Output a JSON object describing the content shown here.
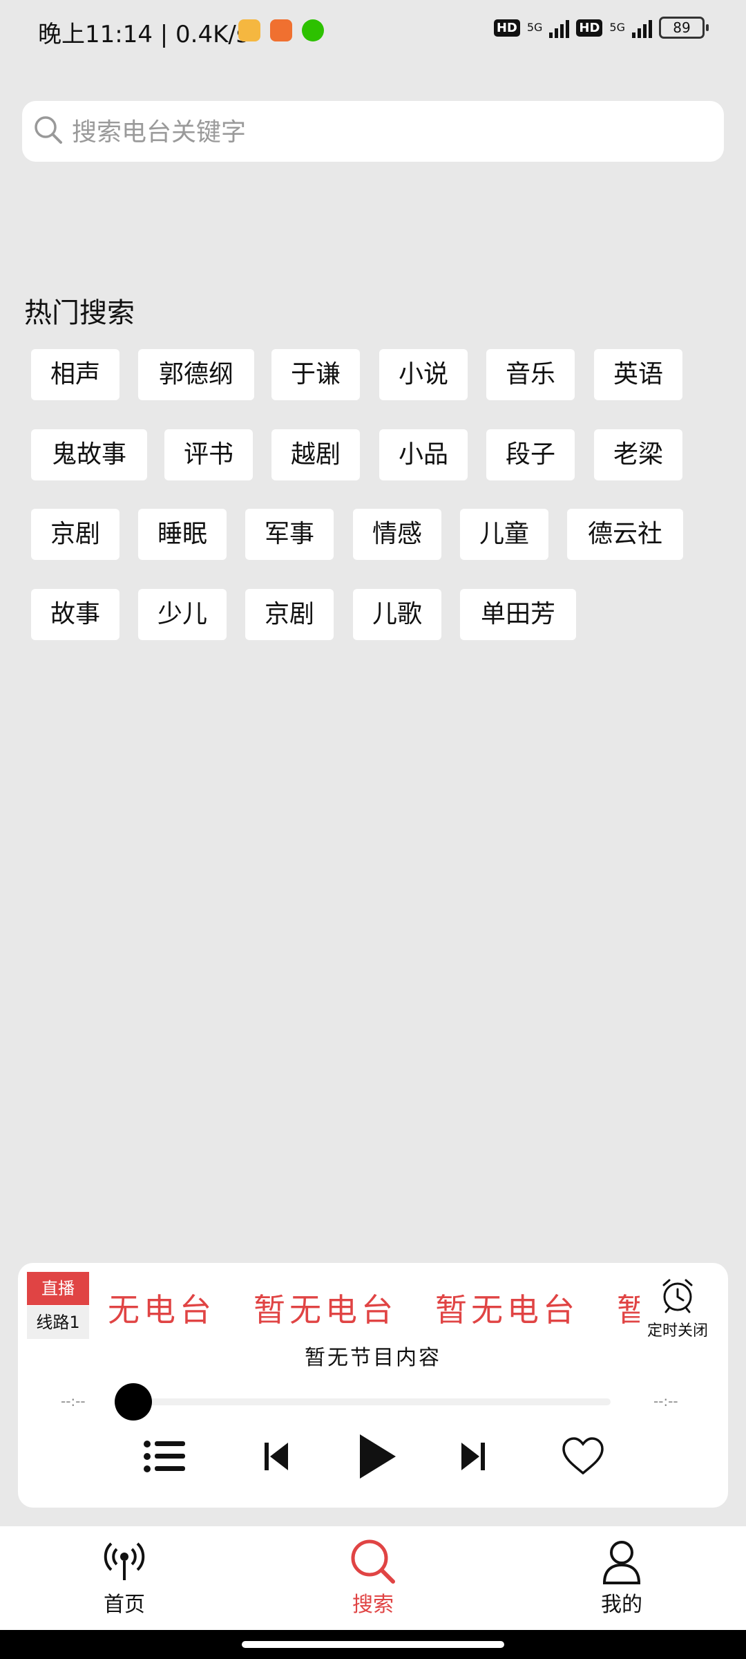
{
  "status_bar": {
    "time": "晚上11:14 | 0.4K/s",
    "hd1": "HD",
    "net1": "5G",
    "hd2": "HD",
    "net2": "5G",
    "battery": "89"
  },
  "search": {
    "placeholder": "搜索电台关键字"
  },
  "hot_search": {
    "title": "热门搜索",
    "tags": [
      "相声",
      "郭德纲",
      "于谦",
      "小说",
      "音乐",
      "英语",
      "鬼故事",
      "评书",
      "越剧",
      "小品",
      "段子",
      "老梁",
      "京剧",
      "睡眠",
      "军事",
      "情感",
      "儿童",
      "德云社",
      "故事",
      "少儿",
      "京剧",
      "儿歌",
      "单田芳"
    ]
  },
  "player": {
    "live_badge": "直播",
    "line_badge": "线路1",
    "marquee": [
      "无电台",
      "暂无电台",
      "暂无电台",
      "暂"
    ],
    "timer_label": "定时关闭",
    "program": "暂无节目内容",
    "time_elapsed": "--:--",
    "time_total": "--:--",
    "progress": 0
  },
  "bottom_nav": {
    "home": "首页",
    "search": "搜索",
    "mine": "我的",
    "active_color": "#e04444"
  }
}
